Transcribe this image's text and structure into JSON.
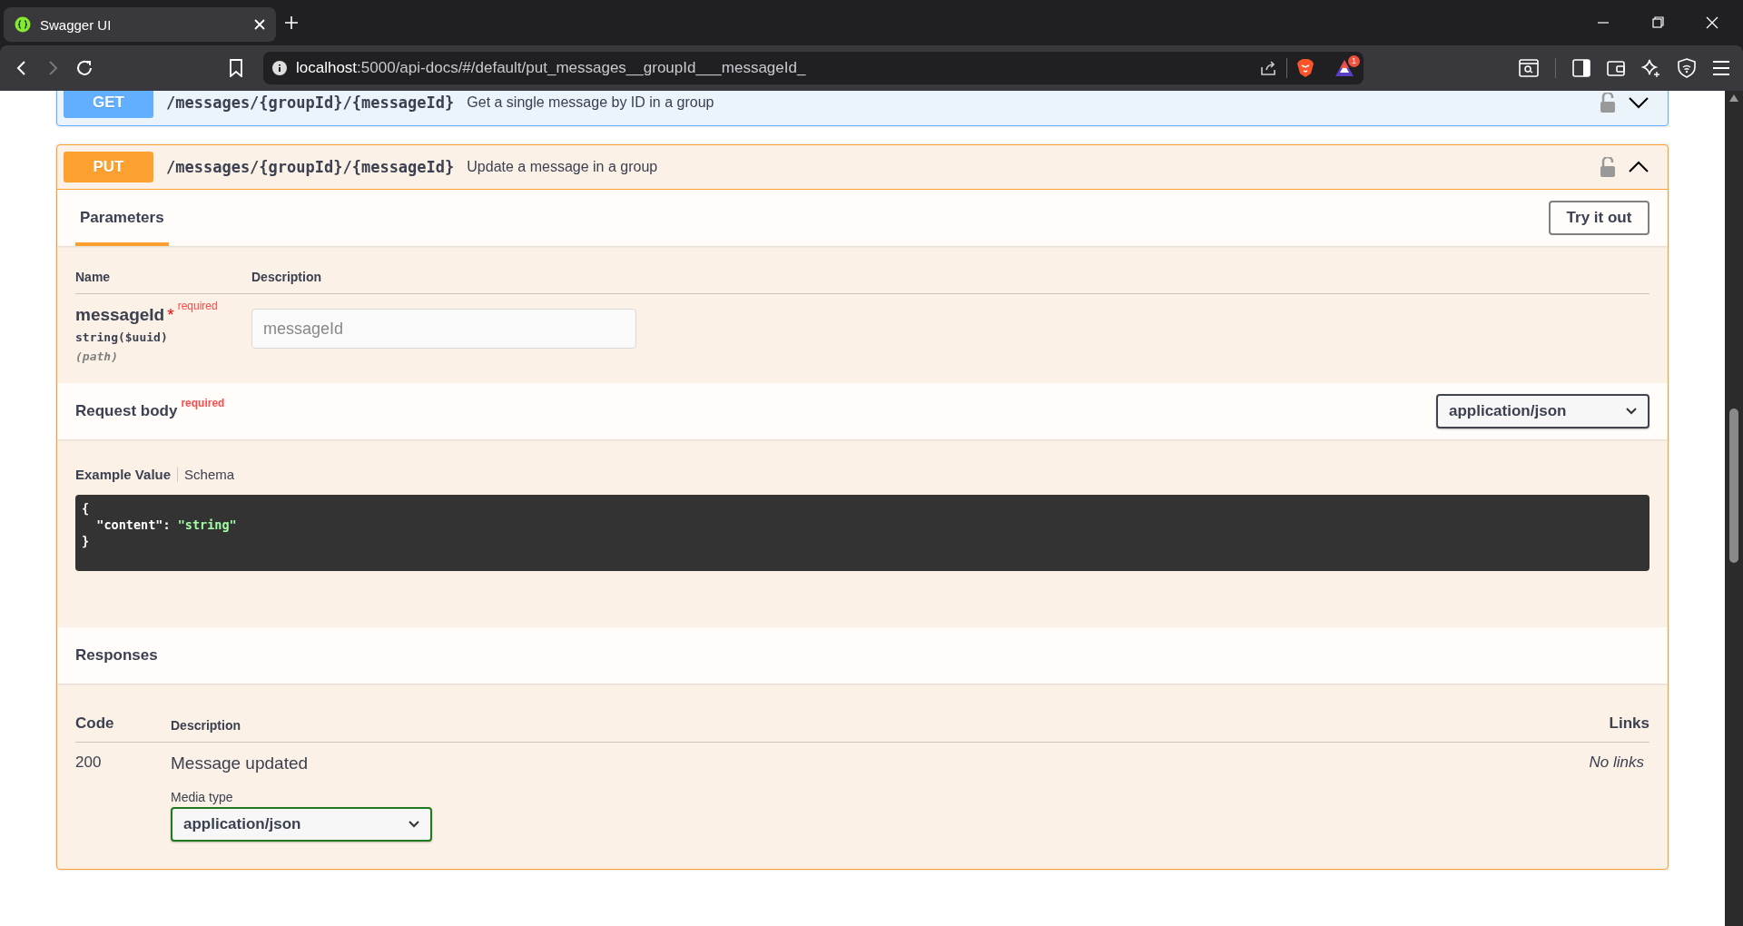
{
  "browser": {
    "tab_title": "Swagger UI",
    "url_host": "localhost",
    "url_rest": ":5000/api-docs/#/default/put_messages__groupId___messageId_",
    "notification_count": "1"
  },
  "operations": [
    {
      "method": "GET",
      "kind": "get",
      "path": "/messages/{groupId}/{messageId}",
      "summary": "Get a single message by ID in a group",
      "expanded": false
    },
    {
      "method": "PUT",
      "kind": "put",
      "path": "/messages/{groupId}/{messageId}",
      "summary": "Update a message in a group",
      "expanded": true
    }
  ],
  "details": {
    "tabs": [
      {
        "label": "Parameters",
        "selected": true
      }
    ],
    "try_button": "Try it out",
    "param_columns": [
      "Name",
      "Description"
    ],
    "parameters": [
      {
        "name": "messageId",
        "required_mark": "*",
        "required": "required",
        "type": "string($uuid)",
        "location": "(path)",
        "placeholder": "messageId"
      }
    ],
    "request_body": {
      "title": "Request body",
      "required": "required",
      "content_type": "application/json",
      "example_tabs": [
        {
          "label": "Example Value",
          "selected": true
        },
        {
          "label": "Schema",
          "selected": false
        }
      ],
      "example_lines": [
        [
          {
            "kind": "punct",
            "text": "{"
          }
        ],
        [
          {
            "kind": "key",
            "text": "  \"content\""
          },
          {
            "kind": "punct",
            "text": ": "
          },
          {
            "kind": "string",
            "text": "\"string\""
          }
        ],
        [
          {
            "kind": "punct",
            "text": "}"
          }
        ]
      ]
    },
    "responses": {
      "title": "Responses",
      "columns": [
        "Code",
        "Description",
        "Links"
      ],
      "rows": [
        {
          "code": "200",
          "description": "Message updated",
          "media_label": "Media type",
          "media_type": "application/json",
          "links": "No links"
        }
      ]
    }
  }
}
